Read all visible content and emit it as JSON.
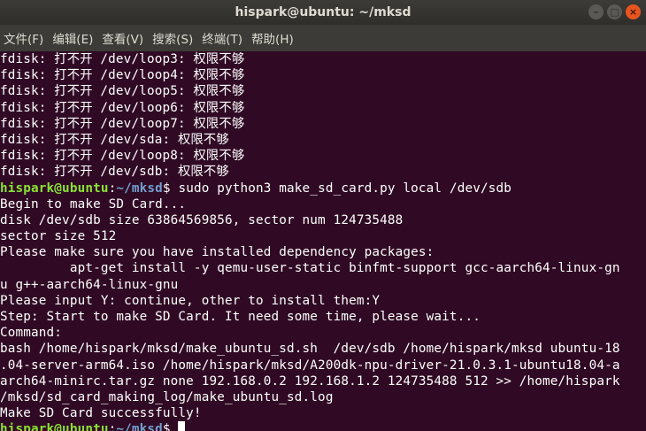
{
  "window": {
    "title": "hispark@ubuntu: ~/mksd",
    "buttons": {
      "minimize": "–",
      "maximize": "□",
      "close": "×"
    }
  },
  "menu": [
    "文件(F)",
    "编辑(E)",
    "查看(V)",
    "搜索(S)",
    "终端(T)",
    "帮助(H)"
  ],
  "terminal": {
    "lines": [
      "fdisk: 打不开 /dev/loop3: 权限不够",
      "fdisk: 打不开 /dev/loop4: 权限不够",
      "fdisk: 打不开 /dev/loop5: 权限不够",
      "fdisk: 打不开 /dev/loop6: 权限不够",
      "fdisk: 打不开 /dev/loop7: 权限不够",
      "fdisk: 打不开 /dev/sda: 权限不够",
      "fdisk: 打不开 /dev/loop8: 权限不够",
      "fdisk: 打不开 /dev/sdb: 权限不够"
    ],
    "prompt": {
      "user": "hispark@ubuntu",
      "sep": ":",
      "path": "~/mksd",
      "symbol": "$ ",
      "command": "sudo python3 make_sd_card.py local /dev/sdb"
    },
    "output": [
      "Begin to make SD Card...",
      "disk /dev/sdb size 63864569856, sector num 124735488",
      "sector size 512",
      "Please make sure you have installed dependency packages:",
      "         apt-get install -y qemu-user-static binfmt-support gcc-aarch64-linux-gn",
      "u g++-aarch64-linux-gnu",
      "Please input Y: continue, other to install them:Y",
      "Step: Start to make SD Card. It need some time, please wait...",
      "Command:",
      "bash /home/hispark/mksd/make_ubuntu_sd.sh  /dev/sdb /home/hispark/mksd ubuntu-18",
      ".04-server-arm64.iso /home/hispark/mksd/A200dk-npu-driver-21.0.3.1-ubuntu18.04-a",
      "arch64-minirc.tar.gz none 192.168.0.2 192.168.1.2 124735488 512 >> /home/hispark",
      "/mksd/sd_card_making_log/make_ubuntu_sd.log",
      "Make SD Card successfully!"
    ],
    "final_prompt": {
      "user": "hispark@ubuntu",
      "sep": ":",
      "path": "~/mksd",
      "symbol": "$ "
    }
  },
  "colors": {
    "background": "#300a24",
    "prompt_user": "#8ae234",
    "prompt_path": "#729fcf",
    "text": "#ffffff"
  }
}
